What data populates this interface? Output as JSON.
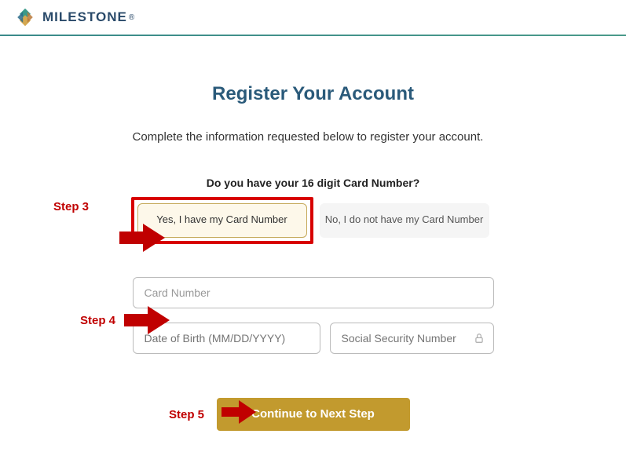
{
  "header": {
    "brand": "MILESTONE"
  },
  "main": {
    "title": "Register Your Account",
    "subtitle": "Complete the information requested below to register your account.",
    "question": "Do you have your 16 digit Card Number?",
    "option_yes": "Yes, I have my Card Number",
    "option_no": "No, I do not have my Card Number",
    "card_placeholder": "Card Number",
    "dob_placeholder": "Date of Birth (MM/DD/YYYY)",
    "ssn_placeholder": "Social Security Number",
    "continue_label": "Continue to Next Step"
  },
  "annotations": {
    "step3": "Step 3",
    "step4": "Step 4",
    "step5": "Step 5"
  }
}
